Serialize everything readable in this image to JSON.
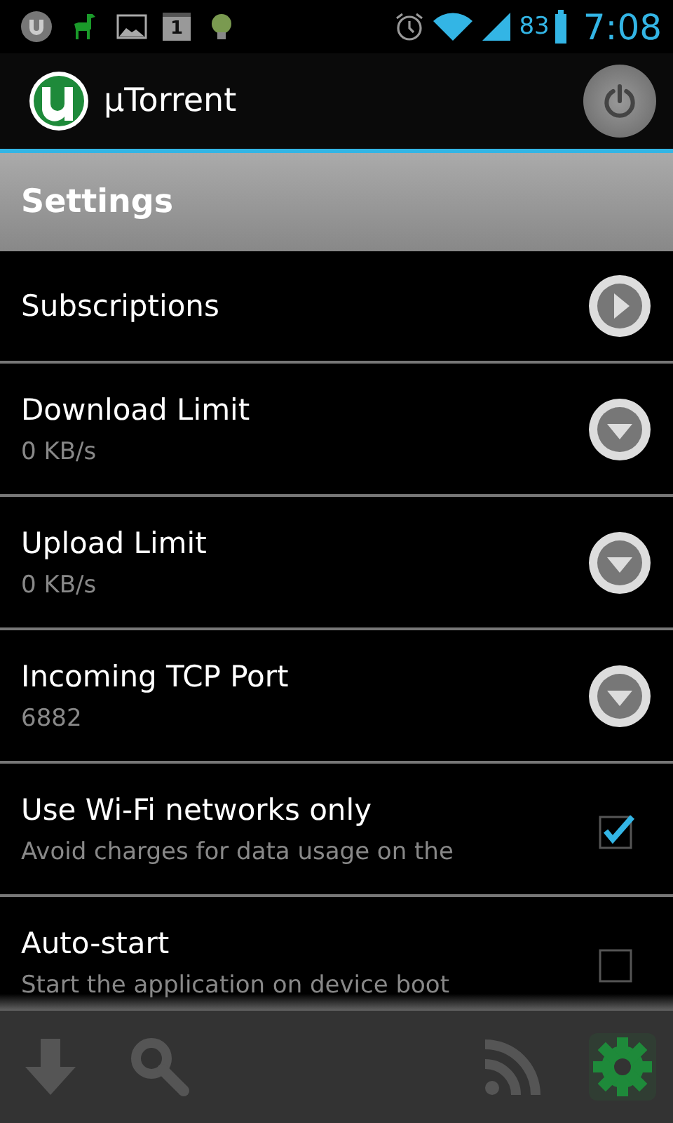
{
  "status_bar": {
    "calendar_day": "1",
    "battery": "83",
    "time": "7:08"
  },
  "app_bar": {
    "title": "µTorrent"
  },
  "header": {
    "title": "Settings"
  },
  "settings": [
    {
      "kind": "navigate",
      "title": "Subscriptions"
    },
    {
      "kind": "dropdown",
      "title": "Download Limit",
      "summary": "0 KB/s"
    },
    {
      "kind": "dropdown",
      "title": "Upload Limit",
      "summary": "0 KB/s"
    },
    {
      "kind": "dropdown",
      "title": "Incoming TCP Port",
      "summary": "6882"
    },
    {
      "kind": "checkbox",
      "title": "Use Wi-Fi networks only",
      "summary": "Avoid charges for data usage on the",
      "checked": true
    },
    {
      "kind": "checkbox",
      "title": "Auto-start",
      "summary": "Start the application on device boot",
      "checked": false
    }
  ],
  "toolbar": [
    {
      "kind": "download",
      "selected": false
    },
    {
      "kind": "search",
      "selected": false
    },
    {
      "kind": "feed",
      "selected": false
    },
    {
      "kind": "settings",
      "selected": true
    }
  ]
}
